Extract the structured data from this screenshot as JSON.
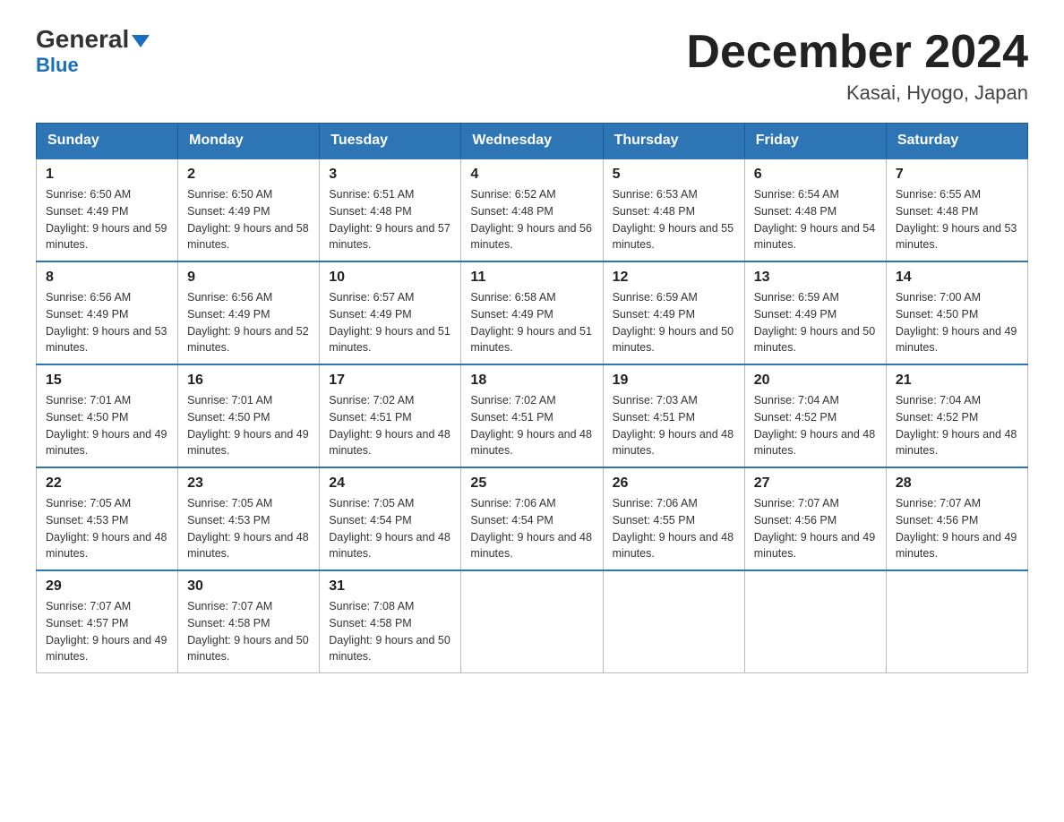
{
  "logo": {
    "general": "General",
    "blue": "Blue"
  },
  "title": "December 2024",
  "subtitle": "Kasai, Hyogo, Japan",
  "days": [
    "Sunday",
    "Monday",
    "Tuesday",
    "Wednesday",
    "Thursday",
    "Friday",
    "Saturday"
  ],
  "weeks": [
    [
      {
        "num": "1",
        "sunrise": "6:50 AM",
        "sunset": "4:49 PM",
        "daylight": "9 hours and 59 minutes."
      },
      {
        "num": "2",
        "sunrise": "6:50 AM",
        "sunset": "4:49 PM",
        "daylight": "9 hours and 58 minutes."
      },
      {
        "num": "3",
        "sunrise": "6:51 AM",
        "sunset": "4:48 PM",
        "daylight": "9 hours and 57 minutes."
      },
      {
        "num": "4",
        "sunrise": "6:52 AM",
        "sunset": "4:48 PM",
        "daylight": "9 hours and 56 minutes."
      },
      {
        "num": "5",
        "sunrise": "6:53 AM",
        "sunset": "4:48 PM",
        "daylight": "9 hours and 55 minutes."
      },
      {
        "num": "6",
        "sunrise": "6:54 AM",
        "sunset": "4:48 PM",
        "daylight": "9 hours and 54 minutes."
      },
      {
        "num": "7",
        "sunrise": "6:55 AM",
        "sunset": "4:48 PM",
        "daylight": "9 hours and 53 minutes."
      }
    ],
    [
      {
        "num": "8",
        "sunrise": "6:56 AM",
        "sunset": "4:49 PM",
        "daylight": "9 hours and 53 minutes."
      },
      {
        "num": "9",
        "sunrise": "6:56 AM",
        "sunset": "4:49 PM",
        "daylight": "9 hours and 52 minutes."
      },
      {
        "num": "10",
        "sunrise": "6:57 AM",
        "sunset": "4:49 PM",
        "daylight": "9 hours and 51 minutes."
      },
      {
        "num": "11",
        "sunrise": "6:58 AM",
        "sunset": "4:49 PM",
        "daylight": "9 hours and 51 minutes."
      },
      {
        "num": "12",
        "sunrise": "6:59 AM",
        "sunset": "4:49 PM",
        "daylight": "9 hours and 50 minutes."
      },
      {
        "num": "13",
        "sunrise": "6:59 AM",
        "sunset": "4:49 PM",
        "daylight": "9 hours and 50 minutes."
      },
      {
        "num": "14",
        "sunrise": "7:00 AM",
        "sunset": "4:50 PM",
        "daylight": "9 hours and 49 minutes."
      }
    ],
    [
      {
        "num": "15",
        "sunrise": "7:01 AM",
        "sunset": "4:50 PM",
        "daylight": "9 hours and 49 minutes."
      },
      {
        "num": "16",
        "sunrise": "7:01 AM",
        "sunset": "4:50 PM",
        "daylight": "9 hours and 49 minutes."
      },
      {
        "num": "17",
        "sunrise": "7:02 AM",
        "sunset": "4:51 PM",
        "daylight": "9 hours and 48 minutes."
      },
      {
        "num": "18",
        "sunrise": "7:02 AM",
        "sunset": "4:51 PM",
        "daylight": "9 hours and 48 minutes."
      },
      {
        "num": "19",
        "sunrise": "7:03 AM",
        "sunset": "4:51 PM",
        "daylight": "9 hours and 48 minutes."
      },
      {
        "num": "20",
        "sunrise": "7:04 AM",
        "sunset": "4:52 PM",
        "daylight": "9 hours and 48 minutes."
      },
      {
        "num": "21",
        "sunrise": "7:04 AM",
        "sunset": "4:52 PM",
        "daylight": "9 hours and 48 minutes."
      }
    ],
    [
      {
        "num": "22",
        "sunrise": "7:05 AM",
        "sunset": "4:53 PM",
        "daylight": "9 hours and 48 minutes."
      },
      {
        "num": "23",
        "sunrise": "7:05 AM",
        "sunset": "4:53 PM",
        "daylight": "9 hours and 48 minutes."
      },
      {
        "num": "24",
        "sunrise": "7:05 AM",
        "sunset": "4:54 PM",
        "daylight": "9 hours and 48 minutes."
      },
      {
        "num": "25",
        "sunrise": "7:06 AM",
        "sunset": "4:54 PM",
        "daylight": "9 hours and 48 minutes."
      },
      {
        "num": "26",
        "sunrise": "7:06 AM",
        "sunset": "4:55 PM",
        "daylight": "9 hours and 48 minutes."
      },
      {
        "num": "27",
        "sunrise": "7:07 AM",
        "sunset": "4:56 PM",
        "daylight": "9 hours and 49 minutes."
      },
      {
        "num": "28",
        "sunrise": "7:07 AM",
        "sunset": "4:56 PM",
        "daylight": "9 hours and 49 minutes."
      }
    ],
    [
      {
        "num": "29",
        "sunrise": "7:07 AM",
        "sunset": "4:57 PM",
        "daylight": "9 hours and 49 minutes."
      },
      {
        "num": "30",
        "sunrise": "7:07 AM",
        "sunset": "4:58 PM",
        "daylight": "9 hours and 50 minutes."
      },
      {
        "num": "31",
        "sunrise": "7:08 AM",
        "sunset": "4:58 PM",
        "daylight": "9 hours and 50 minutes."
      },
      null,
      null,
      null,
      null
    ]
  ]
}
